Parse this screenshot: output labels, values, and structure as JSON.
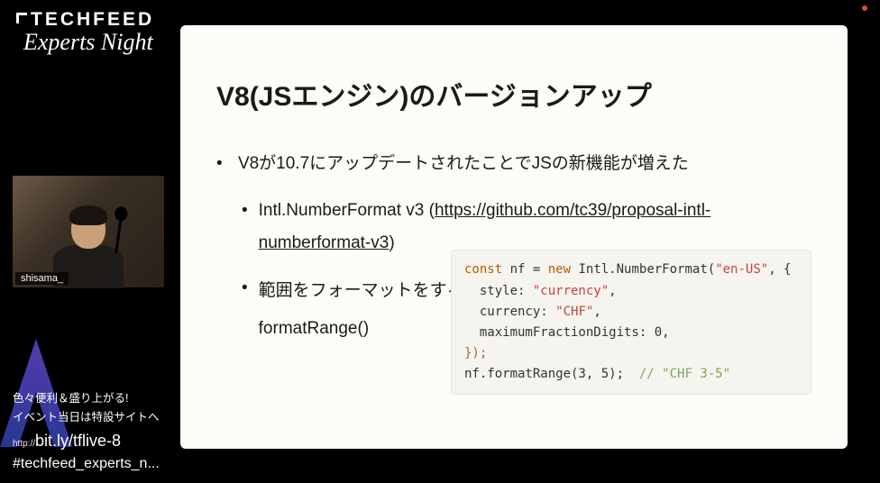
{
  "logo": {
    "main": "TECHFEED",
    "sub": "Experts Night"
  },
  "webcam": {
    "name": "shisama_"
  },
  "promo": {
    "line1": "色々便利＆盛り上がる!",
    "line2": "イベント当日は特設サイトへ",
    "url_prefix": "http://",
    "url": "bit.ly/tflive-8",
    "hashtag": "#techfeed_experts_n..."
  },
  "slide": {
    "title": "V8(JSエンジン)のバージョンアップ",
    "bullet1": "V8が10.7にアップデートされたことでJSの新機能が増えた",
    "sub1_prefix": "Intl.NumberFormat v3 (",
    "sub1_link": "https://github.com/tc39/proposal-intl-numberformat-v3",
    "sub1_suffix": ")",
    "sub2": "範囲をフォーマットをするformatRange()"
  },
  "code": {
    "kw_const": "const",
    "ident_nf": " nf ",
    "eq": "= ",
    "kw_new": "new",
    "ctor": " Intl.NumberFormat(",
    "str_locale": "\"en-US\"",
    "comma_brace": ", {",
    "prop_style": "  style: ",
    "str_currency_val": "\"currency\"",
    "comma1": ",",
    "prop_currency": "  currency: ",
    "str_chf": "\"CHF\"",
    "comma2": ",",
    "prop_maxfrac": "  maximumFractionDigits: 0,",
    "close_brace": "});",
    "call": "nf.formatRange(3, 5);  ",
    "comment": "// \"CHF 3-5\""
  }
}
